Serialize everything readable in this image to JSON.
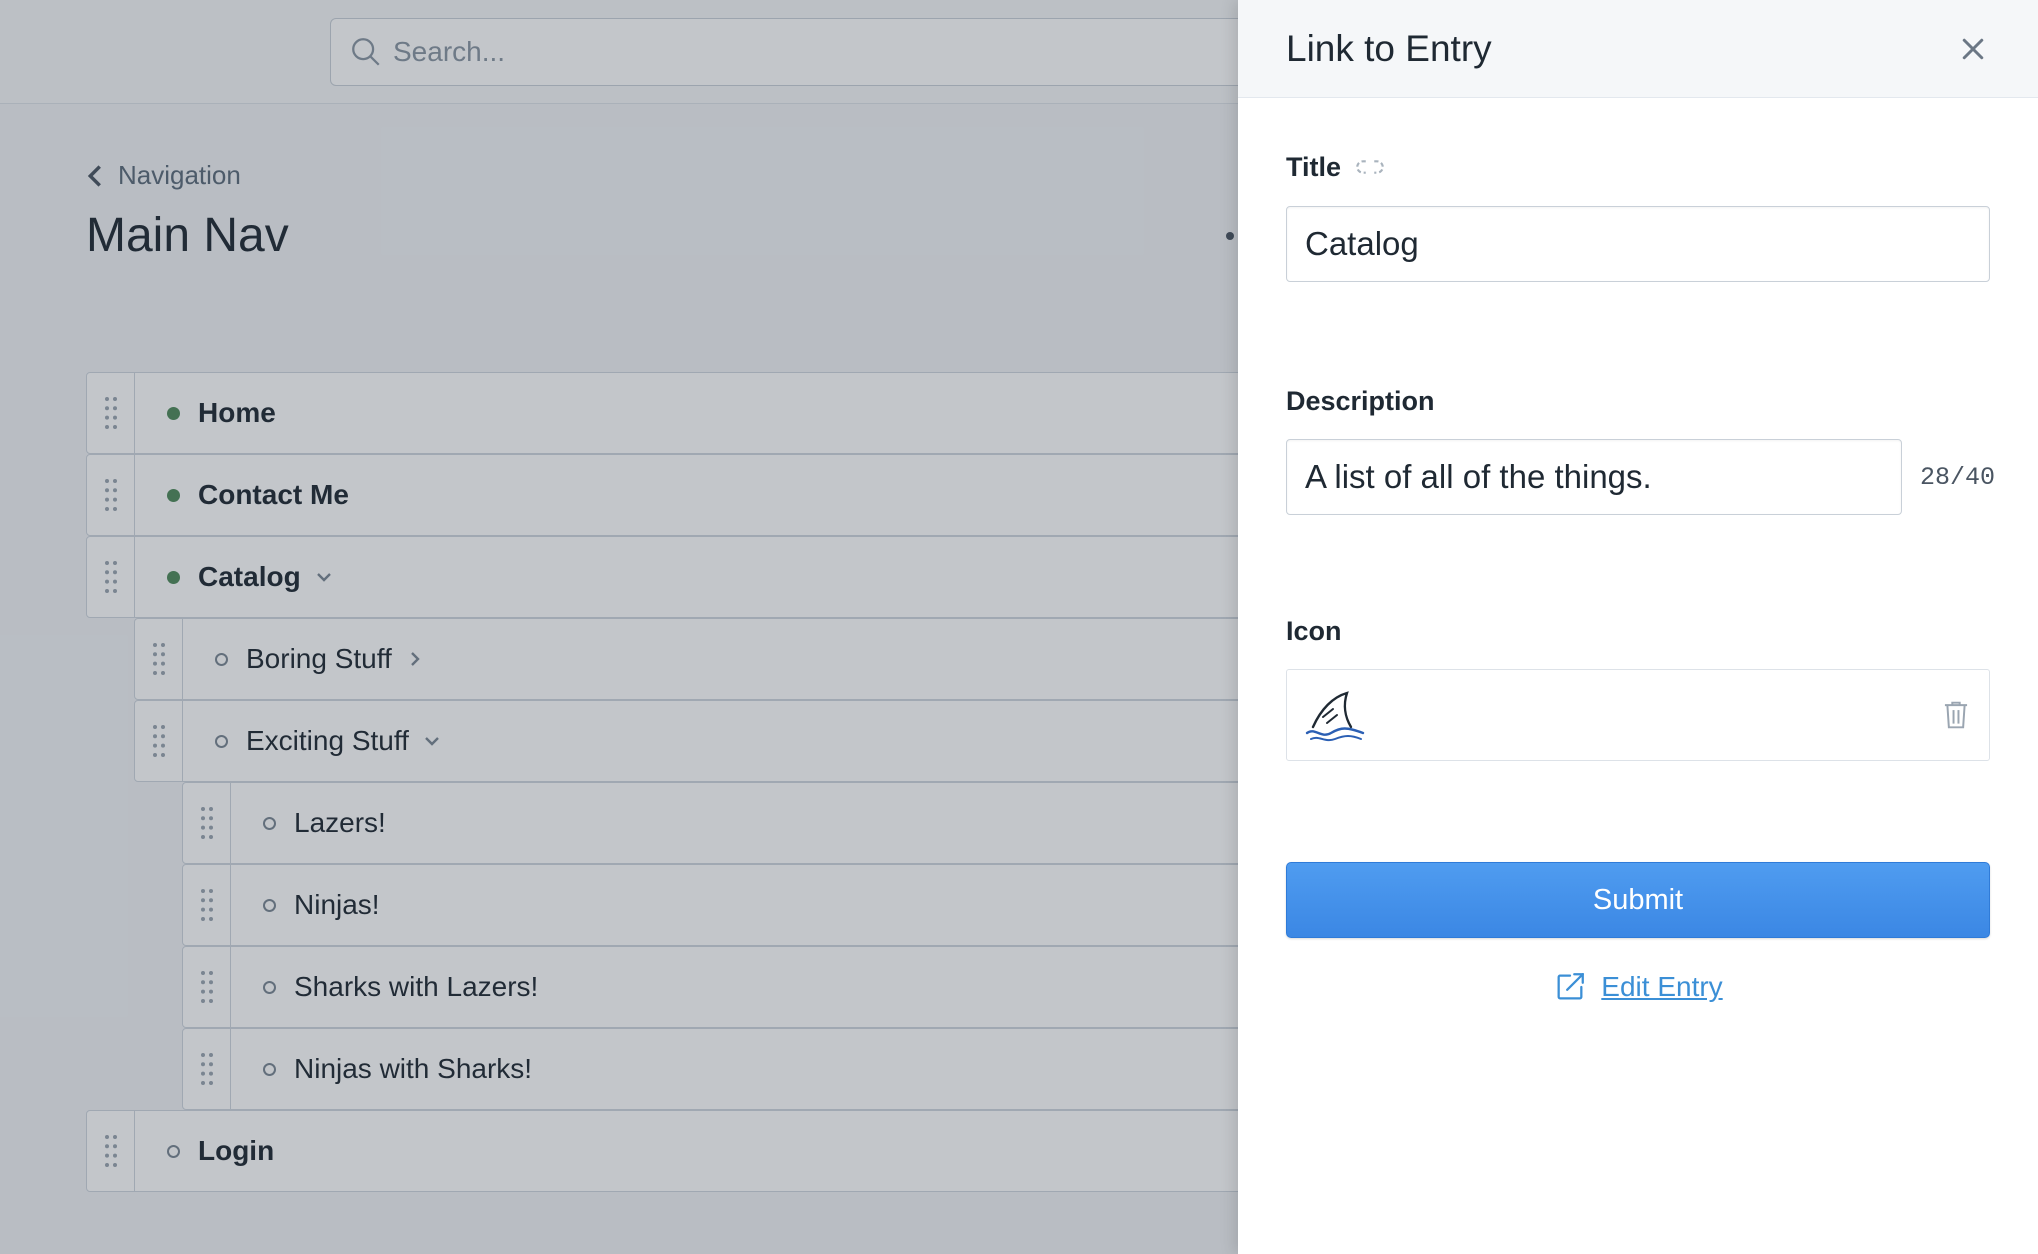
{
  "search": {
    "placeholder": "Search..."
  },
  "breadcrumb": {
    "label": "Navigation"
  },
  "page": {
    "title": "Main Nav"
  },
  "tree": {
    "items": [
      {
        "label": "Home",
        "status": "published",
        "level": 0,
        "expand": "none"
      },
      {
        "label": "Contact Me",
        "status": "published",
        "level": 0,
        "expand": "none"
      },
      {
        "label": "Catalog",
        "status": "published",
        "level": 0,
        "expand": "expanded"
      },
      {
        "label": "Boring Stuff",
        "status": "draft",
        "level": 1,
        "expand": "collapsed"
      },
      {
        "label": "Exciting Stuff",
        "status": "draft",
        "level": 1,
        "expand": "expanded"
      },
      {
        "label": "Lazers!",
        "status": "draft",
        "level": 2,
        "expand": "none"
      },
      {
        "label": "Ninjas!",
        "status": "draft",
        "level": 2,
        "expand": "none"
      },
      {
        "label": "Sharks with Lazers!",
        "status": "draft",
        "level": 2,
        "expand": "none"
      },
      {
        "label": "Ninjas with Sharks!",
        "status": "draft",
        "level": 2,
        "expand": "none"
      },
      {
        "label": "Login",
        "status": "draft",
        "level": 0,
        "expand": "none"
      }
    ]
  },
  "panel": {
    "title": "Link to Entry",
    "title_field": {
      "label": "Title",
      "value": "Catalog"
    },
    "description_field": {
      "label": "Description",
      "value": "A list of all of the things.",
      "counter": "28/40"
    },
    "icon_field": {
      "label": "Icon",
      "icon": "shark-fin-icon"
    },
    "submit_label": "Submit",
    "edit_entry_label": "Edit Entry"
  },
  "colors": {
    "accent": "#3b87e4",
    "published": "#4f8a5b",
    "link": "#3b8fd6"
  }
}
